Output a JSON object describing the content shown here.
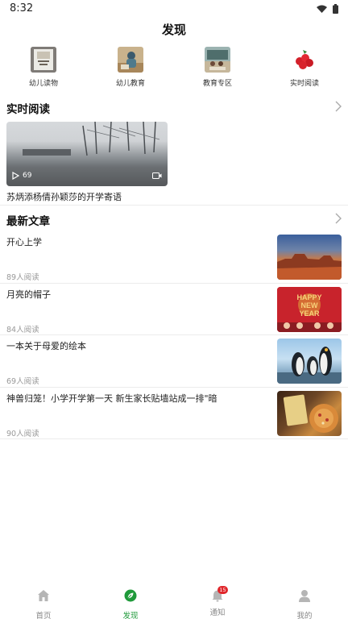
{
  "status": {
    "time": "8:32"
  },
  "header": {
    "title": "发现"
  },
  "categories": [
    {
      "label": "幼儿读物",
      "icon": "book-cover-icon"
    },
    {
      "label": "幼儿教育",
      "icon": "child-photo-icon"
    },
    {
      "label": "教育专区",
      "icon": "classroom-photo-icon"
    },
    {
      "label": "实时阅读",
      "icon": "berries-photo-icon"
    }
  ],
  "realtime": {
    "title": "实时阅读",
    "video": {
      "play_count": "69",
      "title": "苏炳添杨倩孙颖莎的开学寄语"
    }
  },
  "latest": {
    "title": "最新文章",
    "articles": [
      {
        "title": "开心上学",
        "reads": "89人阅读",
        "thumb": "desert"
      },
      {
        "title": "月亮的帽子",
        "reads": "84人阅读",
        "thumb": "happy-new-year",
        "thumb_text": [
          "HAPPY",
          "NEW",
          "YEAR"
        ]
      },
      {
        "title": "一本关于母爱的绘本",
        "reads": "69人阅读",
        "thumb": "penguins"
      },
      {
        "title": "神兽归笼！小学开学第一天 新生家长贴墙站成一排\"暗",
        "reads": "90人阅读",
        "thumb": "food"
      }
    ]
  },
  "tabbar": {
    "items": [
      {
        "label": "首页",
        "icon": "home-icon"
      },
      {
        "label": "发现",
        "icon": "discover-icon",
        "active": true
      },
      {
        "label": "通知",
        "icon": "bell-icon",
        "badge": "15"
      },
      {
        "label": "我的",
        "icon": "profile-icon"
      }
    ]
  },
  "colors": {
    "accent": "#1f9a3a",
    "badge": "#e0262b"
  }
}
